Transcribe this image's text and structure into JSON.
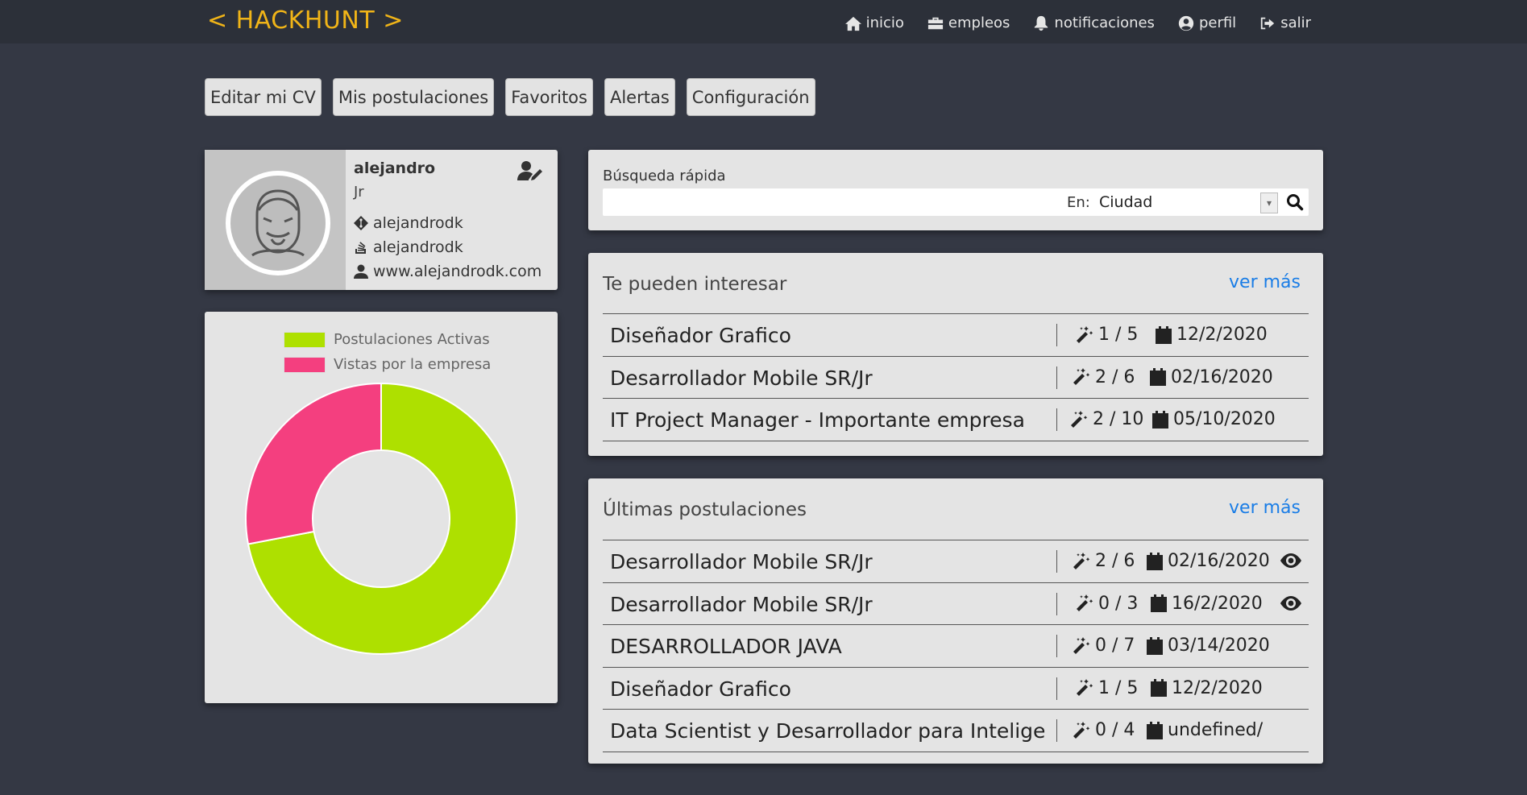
{
  "header": {
    "logo_prefix": "< HACK",
    "logo_bold": "HUNT",
    "logo_suffix": " >",
    "nav": [
      {
        "label": "inicio",
        "icon": "home-icon"
      },
      {
        "label": "empleos",
        "icon": "briefcase-icon"
      },
      {
        "label": "notificaciones",
        "icon": "bell-icon"
      },
      {
        "label": "perfil",
        "icon": "user-circle-icon"
      },
      {
        "label": "salir",
        "icon": "sign-out-icon"
      }
    ]
  },
  "tabs": [
    "Editar mi CV",
    "Mis postulaciones",
    "Favoritos",
    "Alertas",
    "Configuración"
  ],
  "profile": {
    "name": "alejandro",
    "level": "Jr",
    "git": "alejandrodk",
    "stack": "alejandrodk",
    "web": "www.alejandrodk.com"
  },
  "chart_data": {
    "type": "pie",
    "donut": true,
    "legend_position": "top",
    "series": [
      {
        "name": "Postulaciones Activas",
        "value": 72,
        "color": "#aee000"
      },
      {
        "name": "Vistas por la empresa",
        "value": 28,
        "color": "#f43f7f"
      }
    ]
  },
  "search": {
    "label": "Búsqueda rápida",
    "en_label": "En:",
    "select_value": "Ciudad"
  },
  "interest": {
    "title": "Te pueden interesar",
    "ver_mas": "ver más",
    "rows": [
      {
        "name": "Diseñador Grafico",
        "score": "1 / 5",
        "date": "12/2/2020"
      },
      {
        "name": "Desarrollador Mobile SR/Jr",
        "score": "2 / 6",
        "date": "02/16/2020"
      },
      {
        "name": "IT Project Manager - Importante empresa",
        "score": "2 / 10",
        "date": "05/10/2020"
      }
    ]
  },
  "latest": {
    "title": "Últimas postulaciones",
    "ver_mas": "ver más",
    "rows": [
      {
        "name": "Desarrollador Mobile SR/Jr",
        "score": "2 / 6",
        "date": "02/16/2020",
        "viewed": true
      },
      {
        "name": "Desarrollador Mobile SR/Jr",
        "score": "0 / 3",
        "date": "16/2/2020",
        "viewed": true
      },
      {
        "name": "DESARROLLADOR JAVA",
        "score": "0 / 7",
        "date": "03/14/2020",
        "viewed": false
      },
      {
        "name": "Diseñador Grafico",
        "score": "1 / 5",
        "date": "12/2/2020",
        "viewed": false
      },
      {
        "name": "Data Scientist y Desarrollador para Inteligen",
        "score": "0 / 4",
        "date": "undefined/",
        "viewed": false
      }
    ]
  }
}
